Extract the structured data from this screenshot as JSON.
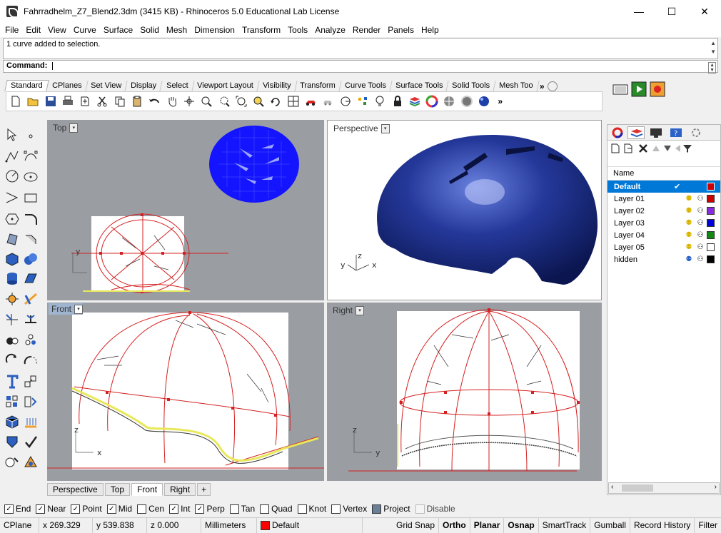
{
  "window": {
    "title": "Fahrradhelm_Z7_Blend2.3dm (3415 KB) - Rhinoceros 5.0 Educational Lab License",
    "minimize": "—",
    "maximize": "☐",
    "close": "✕"
  },
  "menu": [
    "File",
    "Edit",
    "View",
    "Curve",
    "Surface",
    "Solid",
    "Mesh",
    "Dimension",
    "Transform",
    "Tools",
    "Analyze",
    "Render",
    "Panels",
    "Help"
  ],
  "command": {
    "history": "1 curve added to selection.",
    "prompt": "Command:"
  },
  "toolbar_tabs": [
    "Standard",
    "CPlanes",
    "Set View",
    "Display",
    "Select",
    "Viewport Layout",
    "Visibility",
    "Transform",
    "Curve Tools",
    "Surface Tools",
    "Solid Tools",
    "Mesh Too"
  ],
  "toolbar_more": "»",
  "viewports": {
    "top": "Top",
    "perspective": "Perspective",
    "front": "Front",
    "right": "Right",
    "dropdown": "▾"
  },
  "axis": {
    "x": "x",
    "y": "y",
    "z": "z"
  },
  "viewport_tabs": [
    "Perspective",
    "Top",
    "Front",
    "Right"
  ],
  "viewport_tab_add": "+",
  "layers": {
    "header": "Name",
    "rows": [
      {
        "name": "Default",
        "check": "✔",
        "color": "#cc0000"
      },
      {
        "name": "Layer 01",
        "color": "#cc0000"
      },
      {
        "name": "Layer 02",
        "color": "#8a2be2"
      },
      {
        "name": "Layer 03",
        "color": "#0000dd"
      },
      {
        "name": "Layer 04",
        "color": "#118811"
      },
      {
        "name": "Layer 05",
        "color": "#ffffff"
      },
      {
        "name": "hidden",
        "color": "#000000"
      }
    ],
    "bulb": "⚉",
    "lock": "⚇"
  },
  "osnap": [
    {
      "label": "End",
      "checked": true
    },
    {
      "label": "Near",
      "checked": true
    },
    {
      "label": "Point",
      "checked": true
    },
    {
      "label": "Mid",
      "checked": true
    },
    {
      "label": "Cen",
      "checked": false
    },
    {
      "label": "Int",
      "checked": true
    },
    {
      "label": "Perp",
      "checked": true
    },
    {
      "label": "Tan",
      "checked": false
    },
    {
      "label": "Quad",
      "checked": false
    },
    {
      "label": "Knot",
      "checked": false
    },
    {
      "label": "Vertex",
      "checked": false
    },
    {
      "label": "Project",
      "checked": false,
      "filled": true
    },
    {
      "label": "Disable",
      "checked": false,
      "disabled": true
    }
  ],
  "status": {
    "cplane": "CPlane",
    "x": "x 269.329",
    "y": "y 539.838",
    "z": "z 0.000",
    "units": "Millimeters",
    "layer": "Default",
    "layer_color": "#ff0000",
    "grid_snap": "Grid Snap",
    "ortho": "Ortho",
    "planar": "Planar",
    "osnap": "Osnap",
    "smarttrack": "SmartTrack",
    "gumball": "Gumball",
    "record_history": "Record History",
    "filter": "Filter"
  },
  "colors": {
    "curve_red": "#d42020",
    "mesh_blue": "#1414ff",
    "helmet_blue": "#1d2f8a",
    "viewport_gray": "#9a9ea3",
    "selection": "#0078d7"
  }
}
